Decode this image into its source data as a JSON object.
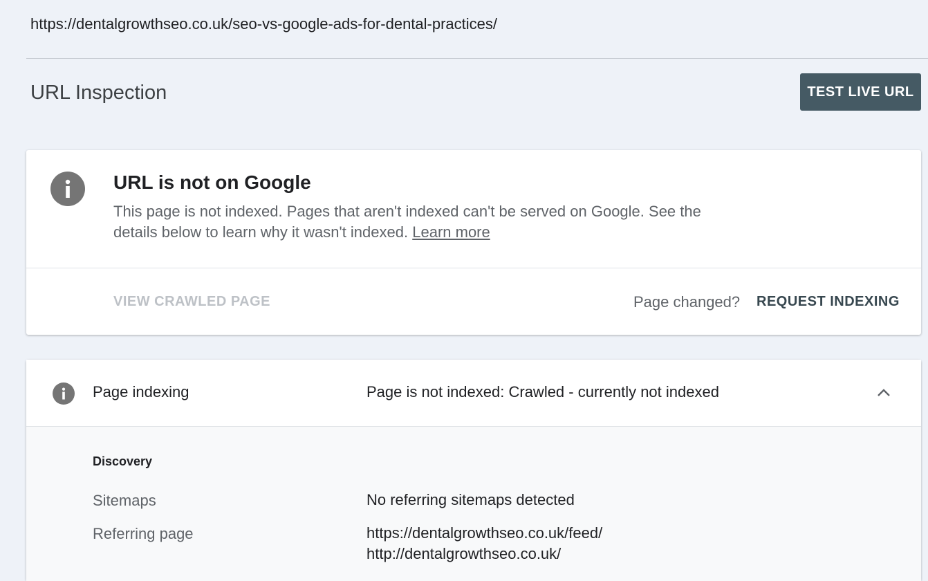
{
  "inspected_url": "https://dentalgrowthseo.co.uk/seo-vs-google-ads-for-dental-practices/",
  "header": {
    "title": "URL Inspection",
    "test_live_url_label": "TEST LIVE URL"
  },
  "status_card": {
    "icon": "info-icon",
    "title": "URL is not on Google",
    "description": "This page is not indexed. Pages that aren't indexed can't be served on Google. See the details below to learn why it wasn't indexed.",
    "learn_more_label": "Learn more",
    "view_crawled_label": "VIEW CRAWLED PAGE",
    "page_changed_text": "Page changed?",
    "request_indexing_label": "REQUEST INDEXING"
  },
  "indexing_card": {
    "icon": "info-icon",
    "label": "Page indexing",
    "status": "Page is not indexed: Crawled - currently not indexed",
    "expanded_icon": "chevron-up-icon",
    "discovery": {
      "heading": "Discovery",
      "rows": [
        {
          "label": "Sitemaps",
          "value_lines": [
            "No referring sitemaps detected"
          ]
        },
        {
          "label": "Referring page",
          "value_lines": [
            "https://dentalgrowthseo.co.uk/feed/",
            "http://dentalgrowthseo.co.uk/"
          ]
        }
      ]
    }
  },
  "colors": {
    "background": "#eef2f8",
    "primary_button": "#455a64",
    "icon_gray": "#757575",
    "disabled_text": "#bdc1c6",
    "action_text": "#37474f"
  }
}
